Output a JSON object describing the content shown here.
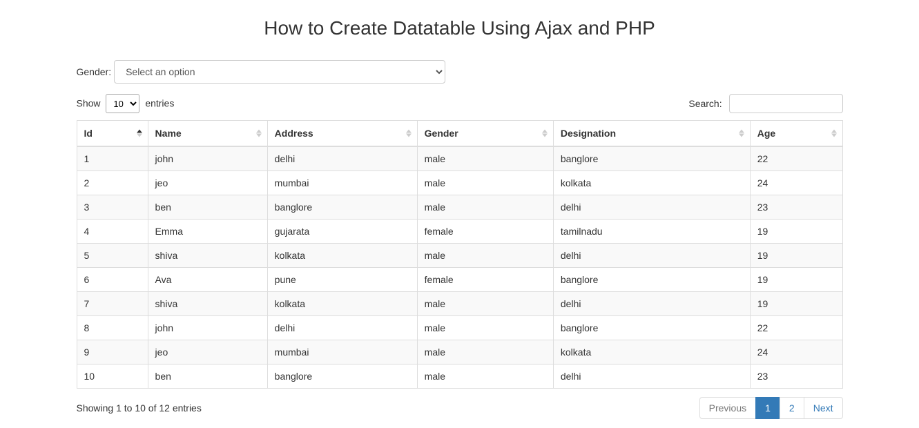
{
  "title": "How to Create Datatable Using Ajax and PHP",
  "filter": {
    "label": "Gender:",
    "selected": "Select an option"
  },
  "length": {
    "show": "Show",
    "entries": "entries",
    "value": "10"
  },
  "search": {
    "label": "Search:",
    "value": ""
  },
  "table": {
    "columns": [
      "Id",
      "Name",
      "Address",
      "Gender",
      "Designation",
      "Age"
    ],
    "sortColumn": 0,
    "sortDir": "asc",
    "rows": [
      [
        "1",
        "john",
        "delhi",
        "male",
        "banglore",
        "22"
      ],
      [
        "2",
        "jeo",
        "mumbai",
        "male",
        "kolkata",
        "24"
      ],
      [
        "3",
        "ben",
        "banglore",
        "male",
        "delhi",
        "23"
      ],
      [
        "4",
        "Emma",
        "gujarata",
        "female",
        "tamilnadu",
        "19"
      ],
      [
        "5",
        "shiva",
        "kolkata",
        "male",
        "delhi",
        "19"
      ],
      [
        "6",
        "Ava",
        "pune",
        "female",
        "banglore",
        "19"
      ],
      [
        "7",
        "shiva",
        "kolkata",
        "male",
        "delhi",
        "19"
      ],
      [
        "8",
        "john",
        "delhi",
        "male",
        "banglore",
        "22"
      ],
      [
        "9",
        "jeo",
        "mumbai",
        "male",
        "kolkata",
        "24"
      ],
      [
        "10",
        "ben",
        "banglore",
        "male",
        "delhi",
        "23"
      ]
    ]
  },
  "info": "Showing 1 to 10 of 12 entries",
  "pagination": {
    "prev": "Previous",
    "next": "Next",
    "pages": [
      "1",
      "2"
    ],
    "active": "1"
  }
}
